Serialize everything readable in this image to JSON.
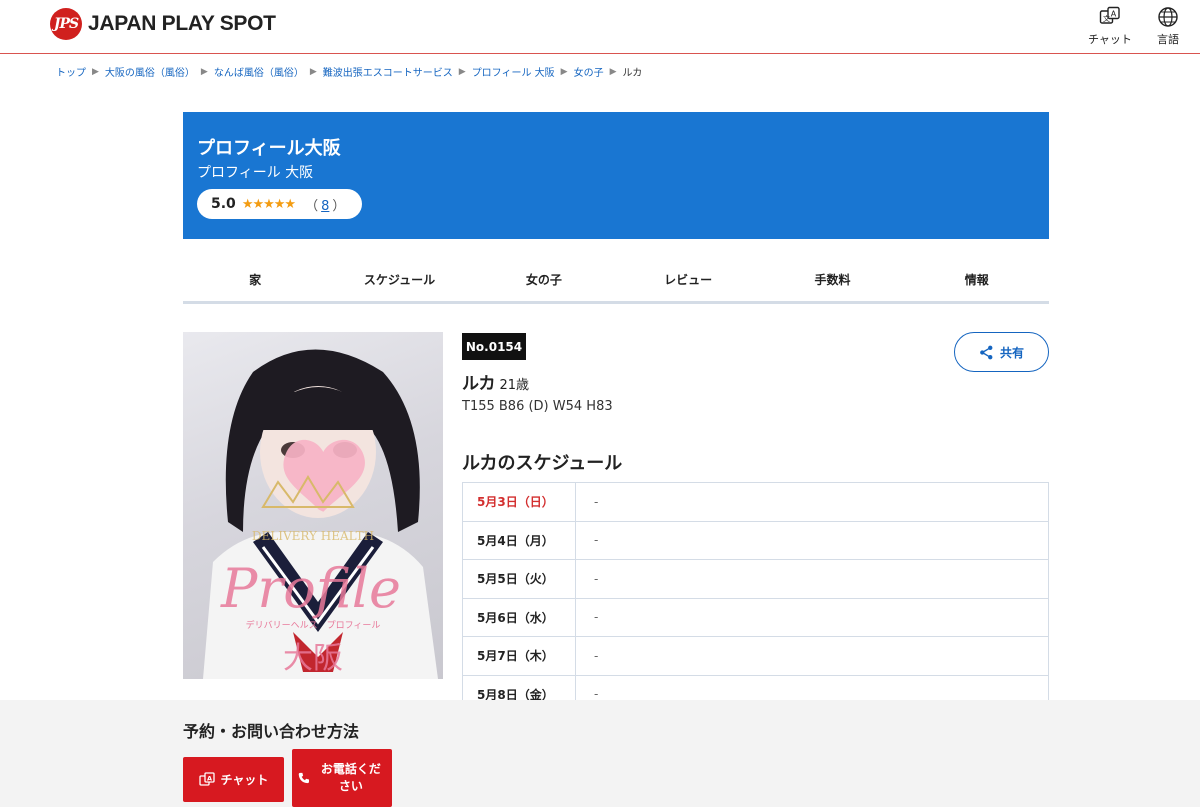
{
  "header": {
    "logo_badge": "JPS",
    "logo_text": "JAPAN PLAY SPOT",
    "chat_label": "チャット",
    "lang_label": "言語"
  },
  "breadcrumb": {
    "items": [
      "トップ",
      "大阪の風俗（風俗）",
      "なんば風俗（風俗）",
      "難波出張エスコートサービス",
      "プロフィール 大阪",
      "女の子"
    ],
    "current": "ルカ"
  },
  "shop": {
    "title": "プロフィール大阪",
    "subtitle": "プロフィール 大阪",
    "score": "5.0",
    "stars": "★★★★★",
    "review_count_open": "（",
    "review_count": "8",
    "review_count_close": "）"
  },
  "tabs": [
    "家",
    "スケジュール",
    "女の子",
    "レビュー",
    "手数料",
    "情報"
  ],
  "photo": {
    "watermark_line1": "DELIVERY HEALTH",
    "watermark_logo": "Profile",
    "watermark_line2": "デリバリーヘルス　プロフィール",
    "watermark_city": "大阪",
    "colors": {
      "watermark_pink": "#e8799a",
      "heart": "#f7b3c6",
      "crown": "#d8b96a"
    }
  },
  "profile": {
    "number": "No.0154",
    "name": "ルカ",
    "age": "21歳",
    "measurements": "T155 B86 (D) W54 H83",
    "share_label": "共有"
  },
  "schedule": {
    "title": "ルカのスケジュール",
    "rows": [
      {
        "day": "5月3日（日）",
        "value": "-",
        "sunday": true
      },
      {
        "day": "5月4日（月）",
        "value": "-",
        "sunday": false
      },
      {
        "day": "5月5日（火）",
        "value": "-",
        "sunday": false
      },
      {
        "day": "5月6日（水）",
        "value": "-",
        "sunday": false
      },
      {
        "day": "5月7日（木）",
        "value": "-",
        "sunday": false
      },
      {
        "day": "5月8日（金）",
        "value": "-",
        "sunday": false
      }
    ]
  },
  "contact": {
    "title": "予約・お問い合わせ方法",
    "chat_label": "チャット",
    "tel_label": "お電話ください"
  },
  "colors": {
    "brand_red": "#d71920",
    "banner_blue": "#1976d2",
    "link_blue": "#1565c0",
    "star_orange": "#f39c12",
    "sunday_red": "#d32f2f"
  }
}
